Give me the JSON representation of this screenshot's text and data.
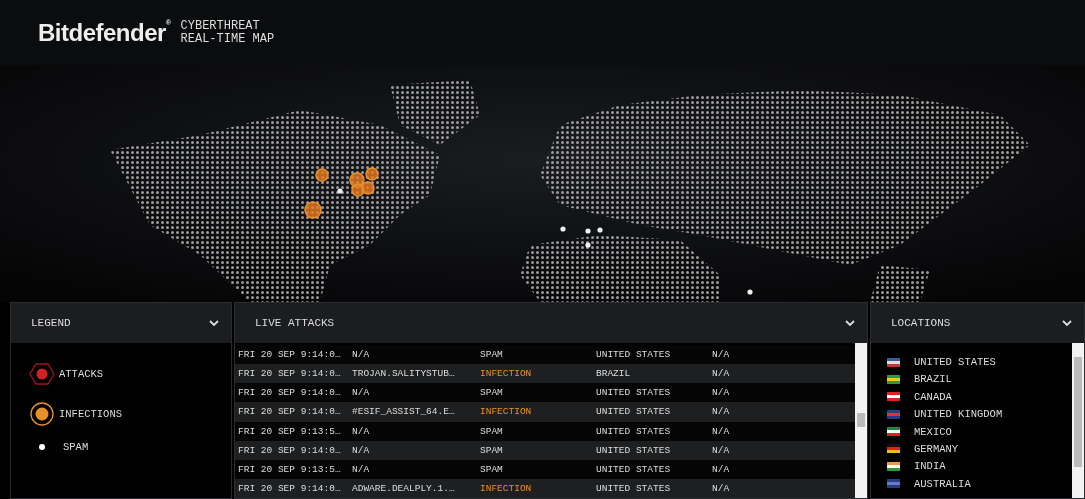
{
  "header": {
    "logo": "Bitdefender$^{®}$",
    "title_line_1": "CYBERTHREAT",
    "title_line_2": "REAL-TIME MAP"
  },
  "legend": {
    "title": "LEGEND",
    "items": [
      {
        "kind": "attack",
        "label": "ATTACKS"
      },
      {
        "kind": "infection",
        "label": "INFECTIONS"
      },
      {
        "kind": "spam",
        "label": "SPAM"
      }
    ]
  },
  "live_attacks": {
    "title": "LIVE ATTACKS",
    "rows": [
      {
        "time": "FRI 20 SEP 9:14:0…",
        "name": "N/A",
        "type": "SPAM",
        "kind": "spam",
        "country": "UNITED STATES",
        "column_5": "N/A"
      },
      {
        "time": "FRI 20 SEP 9:14:0…",
        "name": "TROJAN.SALITYSTUB…",
        "type": "INFECTION",
        "kind": "infection",
        "country": "BRAZIL",
        "column_5": "N/A"
      },
      {
        "time": "FRI 20 SEP 9:14:0…",
        "name": "N/A",
        "type": "SPAM",
        "kind": "spam",
        "country": "UNITED STATES",
        "column_5": "N/A"
      },
      {
        "time": "FRI 20 SEP 9:14:0…",
        "name": "#ESIF_ASSIST_64.E…",
        "type": "INFECTION",
        "kind": "infection",
        "country": "UNITED STATES",
        "column_5": "N/A"
      },
      {
        "time": "FRI 20 SEP 9:13:5…",
        "name": "N/A",
        "type": "SPAM",
        "kind": "spam",
        "country": "UNITED STATES",
        "column_5": "N/A"
      },
      {
        "time": "FRI 20 SEP 9:14:0…",
        "name": "N/A",
        "type": "SPAM",
        "kind": "spam",
        "country": "UNITED STATES",
        "column_5": "N/A"
      },
      {
        "time": "FRI 20 SEP 9:13:5…",
        "name": "N/A",
        "type": "SPAM",
        "kind": "spam",
        "country": "UNITED STATES",
        "column_5": "N/A"
      },
      {
        "time": "FRI 20 SEP 9:14:0…",
        "name": "ADWARE.DEALPLY.1.…",
        "type": "INFECTION",
        "kind": "infection",
        "country": "UNITED STATES",
        "column_5": "N/A"
      }
    ]
  },
  "locations": {
    "title": "LOCATIONS",
    "items": [
      {
        "name": "UNITED STATES"
      },
      {
        "name": "BRAZIL"
      },
      {
        "name": "CANADA"
      },
      {
        "name": "UNITED KINGDOM"
      },
      {
        "name": "MEXICO"
      },
      {
        "name": "GERMANY"
      },
      {
        "name": "INDIA"
      },
      {
        "name": "AUSTRALIA"
      }
    ]
  }
}
